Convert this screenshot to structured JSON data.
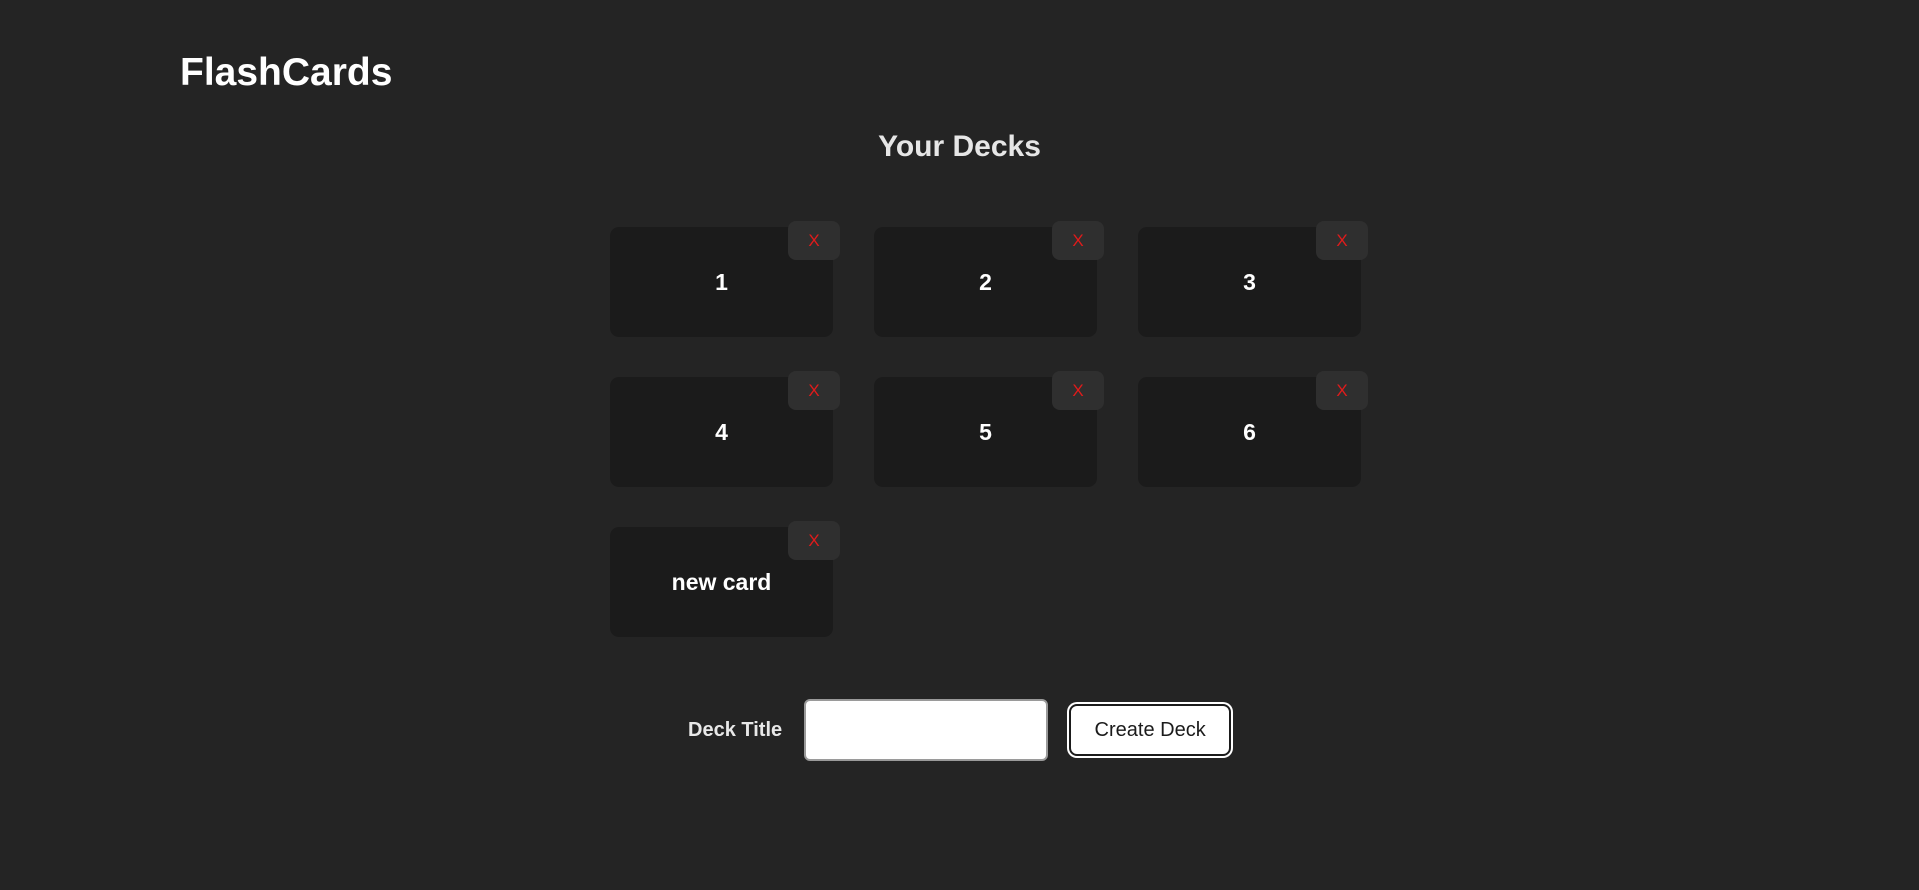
{
  "header": {
    "app_title": "FlashCards"
  },
  "main": {
    "section_title": "Your Decks",
    "decks": [
      {
        "title": "1",
        "delete_label": "X"
      },
      {
        "title": "2",
        "delete_label": "X"
      },
      {
        "title": "3",
        "delete_label": "X"
      },
      {
        "title": "4",
        "delete_label": "X"
      },
      {
        "title": "5",
        "delete_label": "X"
      },
      {
        "title": "6",
        "delete_label": "X"
      },
      {
        "title": "new card",
        "delete_label": "X"
      }
    ]
  },
  "form": {
    "label": "Deck Title",
    "input_value": "",
    "input_placeholder": "",
    "submit_label": "Create Deck"
  },
  "colors": {
    "background": "#242424",
    "card_background": "#1b1b1b",
    "delete_button_background": "#2f2f2f",
    "delete_text": "#e01b1b",
    "text": "#ffffff"
  }
}
